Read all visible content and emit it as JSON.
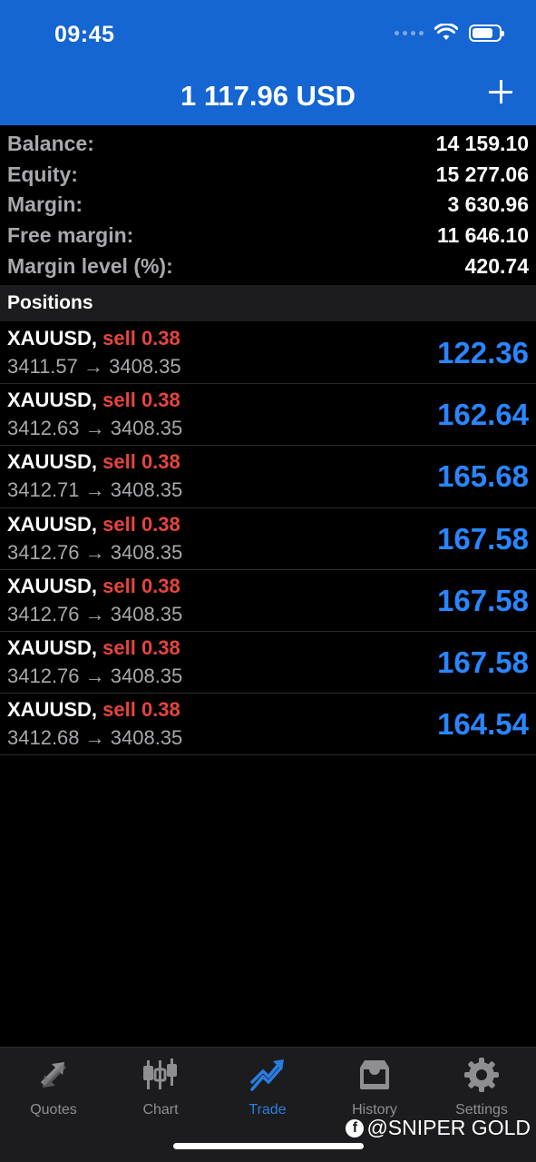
{
  "status_bar": {
    "time": "09:45"
  },
  "header": {
    "title": "1 117.96 USD"
  },
  "summary": [
    {
      "label": "Balance:",
      "value": "14 159.10"
    },
    {
      "label": "Equity:",
      "value": "15 277.06"
    },
    {
      "label": "Margin:",
      "value": "3 630.96"
    },
    {
      "label": "Free margin:",
      "value": "11 646.10"
    },
    {
      "label": "Margin level (%):",
      "value": "420.74"
    }
  ],
  "positions_header": "Positions",
  "positions": [
    {
      "symbol": "XAUUSD,",
      "side": "sell 0.38",
      "prices": "3411.57 → 3408.35",
      "profit": "122.36"
    },
    {
      "symbol": "XAUUSD,",
      "side": "sell 0.38",
      "prices": "3412.63 → 3408.35",
      "profit": "162.64"
    },
    {
      "symbol": "XAUUSD,",
      "side": "sell 0.38",
      "prices": "3412.71 → 3408.35",
      "profit": "165.68"
    },
    {
      "symbol": "XAUUSD,",
      "side": "sell 0.38",
      "prices": "3412.76 → 3408.35",
      "profit": "167.58"
    },
    {
      "symbol": "XAUUSD,",
      "side": "sell 0.38",
      "prices": "3412.76 → 3408.35",
      "profit": "167.58"
    },
    {
      "symbol": "XAUUSD,",
      "side": "sell 0.38",
      "prices": "3412.76 → 3408.35",
      "profit": "167.58"
    },
    {
      "symbol": "XAUUSD,",
      "side": "sell 0.38",
      "prices": "3412.68 → 3408.35",
      "profit": "164.54"
    }
  ],
  "tabs": [
    {
      "label": "Quotes",
      "icon": "quotes-icon",
      "active": false
    },
    {
      "label": "Chart",
      "icon": "chart-icon",
      "active": false
    },
    {
      "label": "Trade",
      "icon": "trade-icon",
      "active": true
    },
    {
      "label": "History",
      "icon": "history-icon",
      "active": false
    },
    {
      "label": "Settings",
      "icon": "settings-icon",
      "active": false
    }
  ],
  "watermark": "@SNIPER GOLD",
  "colors": {
    "header_bg": "#1565d2",
    "sell": "#e6453d",
    "profit": "#2a86ff",
    "active_tab": "#2a7de1"
  }
}
